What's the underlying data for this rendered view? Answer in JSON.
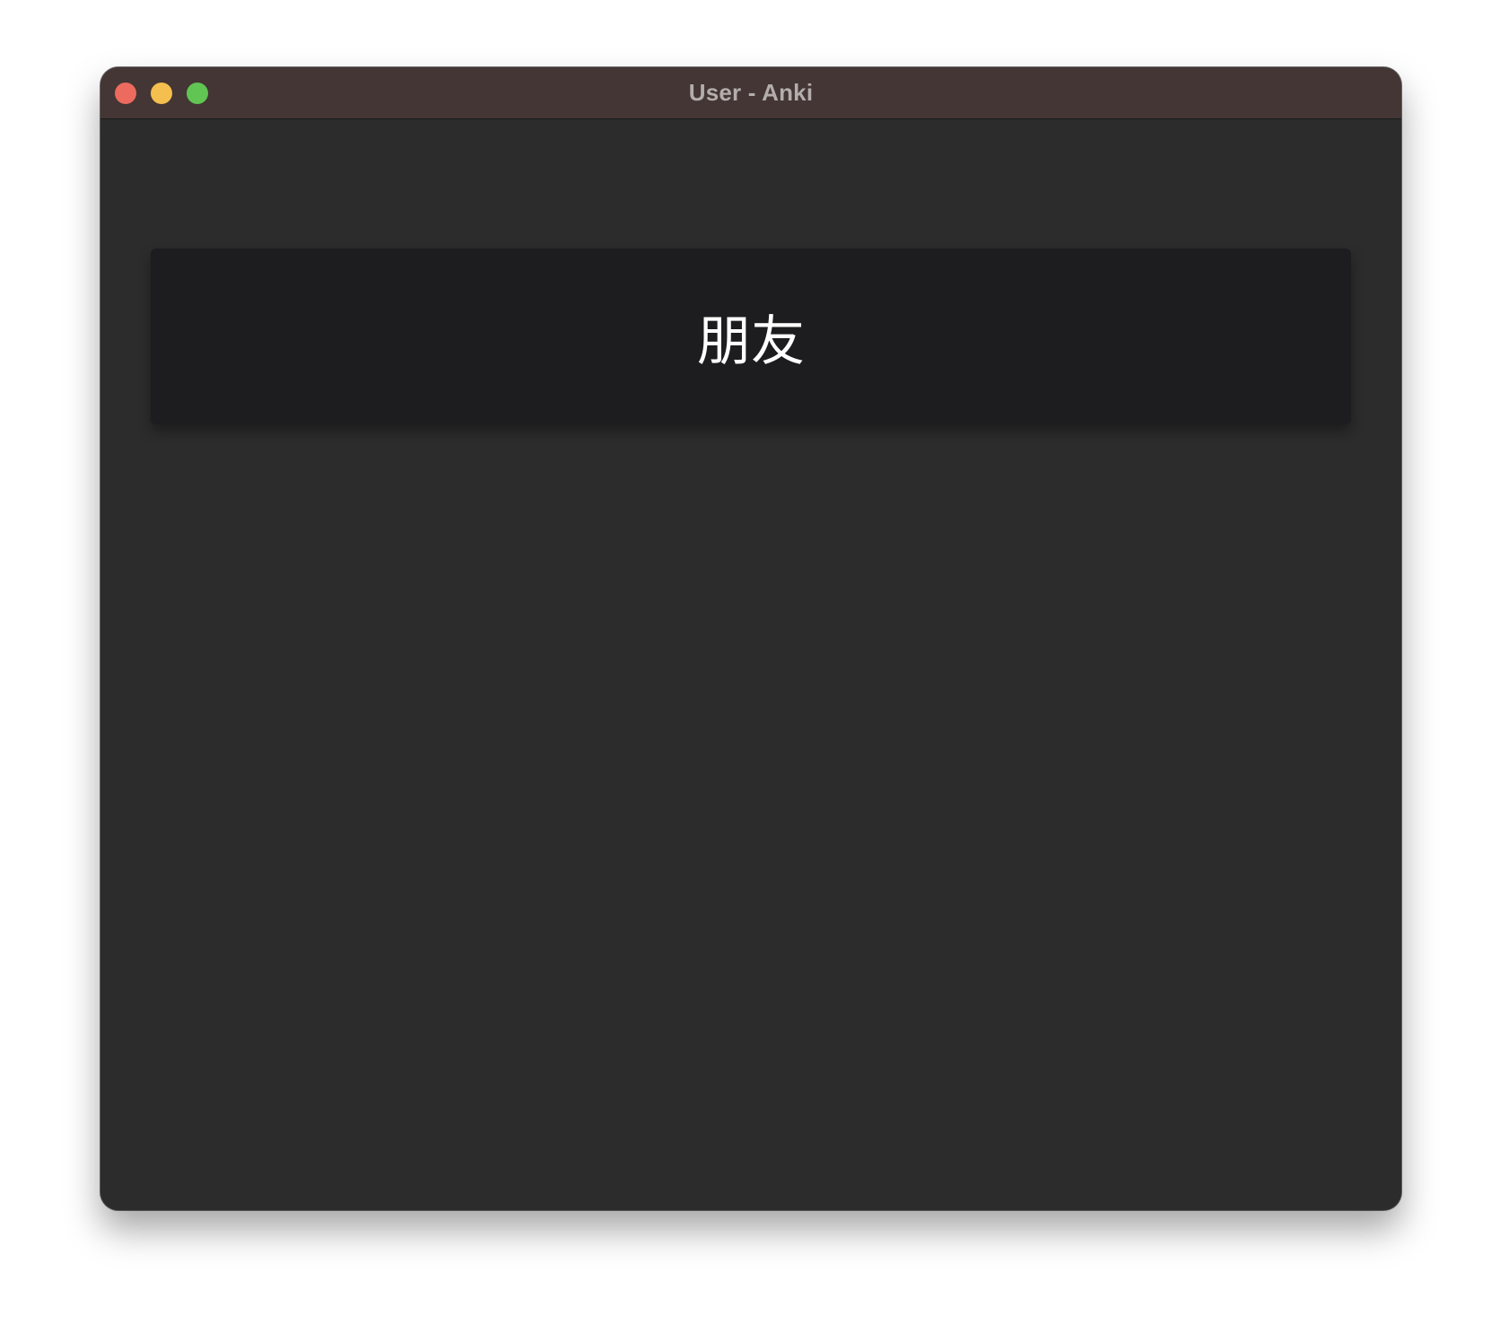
{
  "window": {
    "title": "User - Anki",
    "controls": {
      "close_color": "#ed6a5e",
      "minimize_color": "#f5bf4f",
      "zoom_color": "#61c554"
    }
  },
  "card": {
    "front_text": "朋友"
  },
  "colors": {
    "titlebar": "#433634",
    "background": "#2c2c2c",
    "card": "#1d1d1f",
    "text": "#ffffff"
  }
}
